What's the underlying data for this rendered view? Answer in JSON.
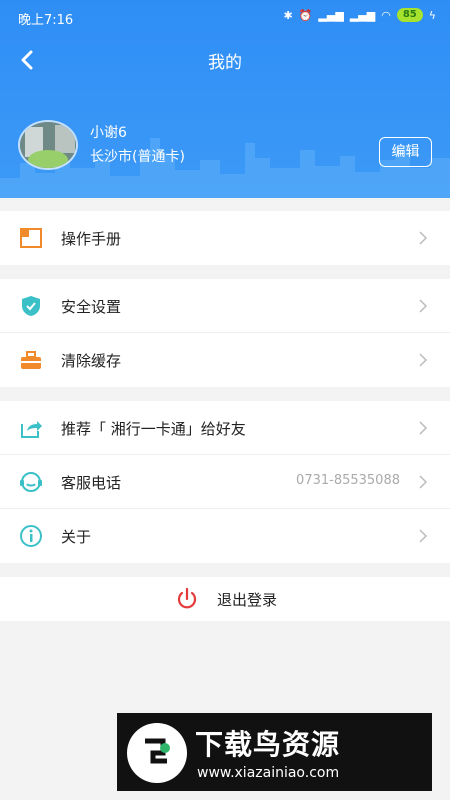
{
  "status_bar": {
    "time": "晚上7:16",
    "battery": "85"
  },
  "nav": {
    "title": "我的"
  },
  "profile": {
    "name": "小谢6",
    "city": "长沙市(普通卡)",
    "edit_label": "编辑"
  },
  "menu_groups": [
    {
      "items": [
        {
          "label": "操作手册",
          "icon": "manual-icon"
        }
      ]
    },
    {
      "items": [
        {
          "label": "安全设置",
          "icon": "shield-icon"
        },
        {
          "label": "清除缓存",
          "icon": "clear-cache-icon"
        }
      ]
    },
    {
      "items": [
        {
          "label": "推荐「 湘行一卡通」给好友",
          "icon": "share-icon"
        },
        {
          "label": "客服电话",
          "icon": "customer-service-icon",
          "value": "0731-85535088"
        },
        {
          "label": "关于",
          "icon": "info-icon"
        }
      ]
    }
  ],
  "logout": {
    "label": "退出登录"
  },
  "watermark": {
    "title": "下载鸟资源",
    "url": "www.xiazainiao.com"
  },
  "colors": {
    "header_blue": "#3a97f6",
    "accent_orange": "#f08a2a",
    "accent_teal": "#3cc0c8",
    "logout_red": "#e33b3b"
  }
}
